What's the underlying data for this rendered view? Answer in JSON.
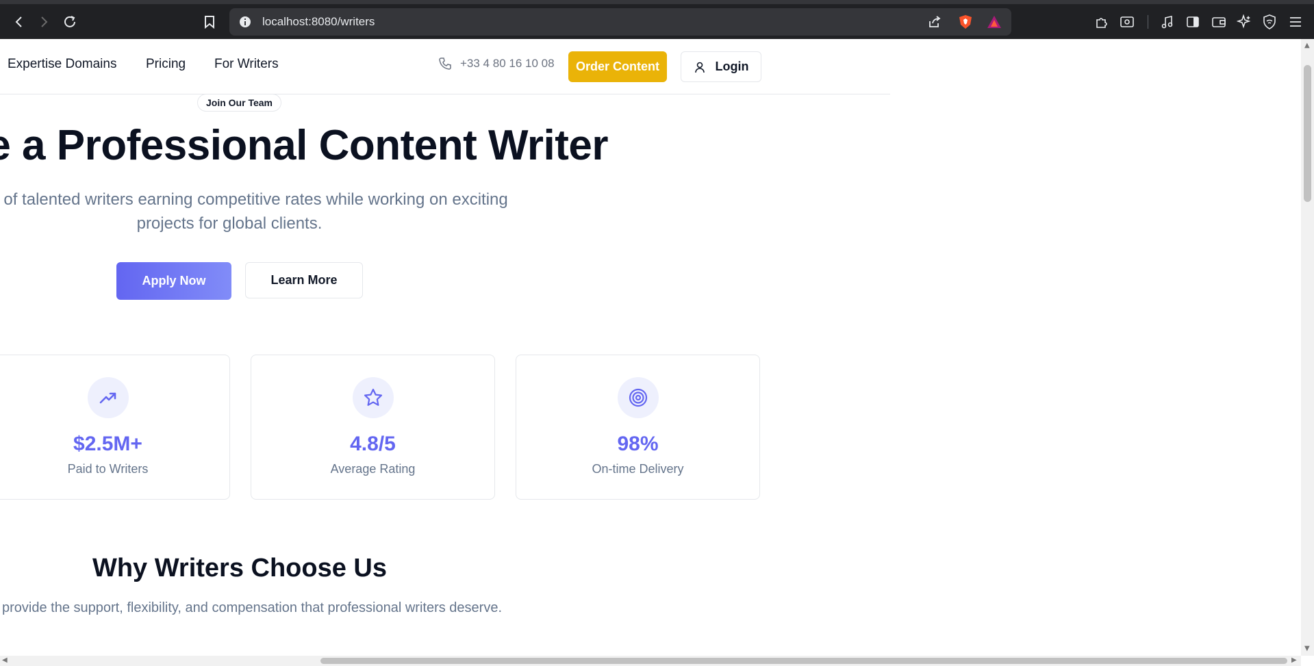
{
  "browser": {
    "url": "localhost:8080/writers"
  },
  "header": {
    "nav": [
      {
        "label": "Expertise Domains"
      },
      {
        "label": "Pricing"
      },
      {
        "label": "For Writers"
      }
    ],
    "phone": "+33 4 80 16 10 08",
    "order_label": "Order Content",
    "login_label": "Login"
  },
  "hero": {
    "badge": "Join Our Team",
    "title": "ne a Professional Content Writer",
    "subtitle_line1": "eds of talented writers earning competitive rates while working on exciting",
    "subtitle_line2": "projects for global clients.",
    "apply_label": "Apply Now",
    "learn_label": "Learn More"
  },
  "stats": [
    {
      "icon": "trending-up-icon",
      "value": "$2.5M+",
      "label": "Paid to Writers"
    },
    {
      "icon": "star-icon",
      "value": "4.8/5",
      "label": "Average Rating"
    },
    {
      "icon": "target-icon",
      "value": "98%",
      "label": "On-time Delivery"
    }
  ],
  "why": {
    "title": "Why Writers Choose Us",
    "subtitle": "provide the support, flexibility, and compensation that professional writers deserve."
  },
  "colors": {
    "accent": "#6366f1",
    "order_button": "#eab308",
    "heading": "#0b1120",
    "muted": "#64748b",
    "chrome": "#202124"
  }
}
